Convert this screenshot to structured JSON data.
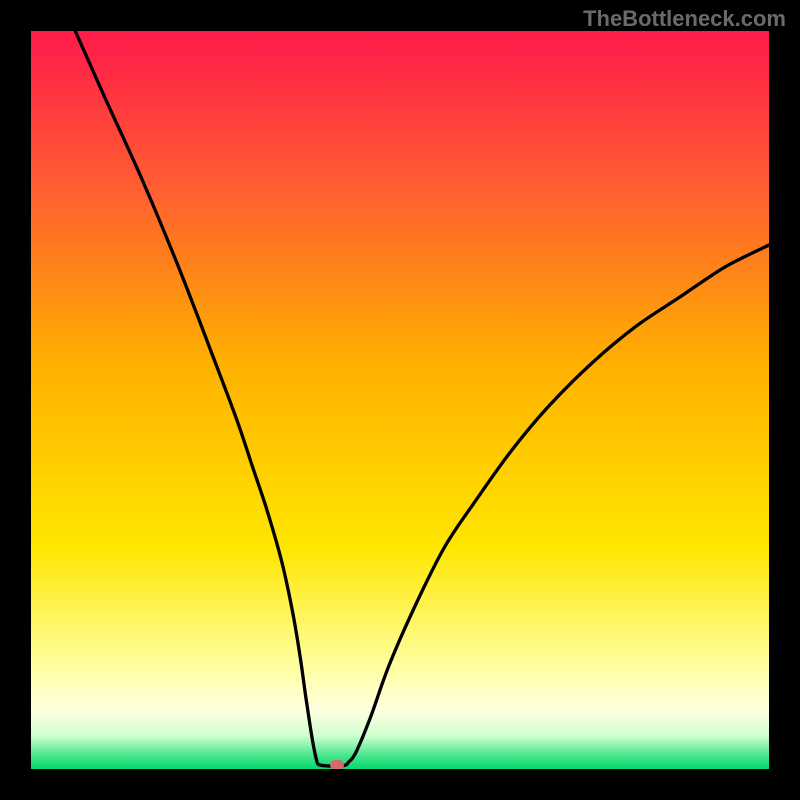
{
  "brand": {
    "label": "TheBottleneck.com"
  },
  "chart_data": {
    "type": "line",
    "title": "",
    "xlabel": "",
    "ylabel": "",
    "xlim": [
      0,
      100
    ],
    "ylim": [
      0,
      100
    ],
    "gradient_stops": [
      {
        "pct": 0,
        "color": "#ff1a4b"
      },
      {
        "pct": 20,
        "color": "#ff5a33"
      },
      {
        "pct": 45,
        "color": "#ffb000"
      },
      {
        "pct": 70,
        "color": "#ffe600"
      },
      {
        "pct": 86,
        "color": "#ffffa0"
      },
      {
        "pct": 92,
        "color": "#ffffe0"
      },
      {
        "pct": 95.5,
        "color": "#d0ffd0"
      },
      {
        "pct": 98,
        "color": "#50e890"
      },
      {
        "pct": 100,
        "color": "#00d86a"
      }
    ],
    "series": [
      {
        "name": "bottleneck-curve",
        "x": [
          6,
          10,
          15,
          20,
          25,
          28,
          30,
          32,
          34,
          35.5,
          36.5,
          37.2,
          37.8,
          38.3,
          38.7,
          39.0,
          40.5,
          42.5,
          43.0,
          44.0,
          46.0,
          48.5,
          52,
          56,
          60,
          65,
          70,
          76,
          82,
          88,
          94,
          100
        ],
        "y": [
          100,
          91,
          80,
          68,
          55,
          47,
          41,
          35,
          28,
          21,
          15,
          10,
          6,
          3,
          1.2,
          0.6,
          0.4,
          0.5,
          0.9,
          2.2,
          7,
          14,
          22,
          30,
          36,
          43,
          49,
          55,
          60,
          64,
          68,
          71
        ]
      }
    ],
    "marker": {
      "x": 41.5,
      "y": 0.5
    }
  }
}
